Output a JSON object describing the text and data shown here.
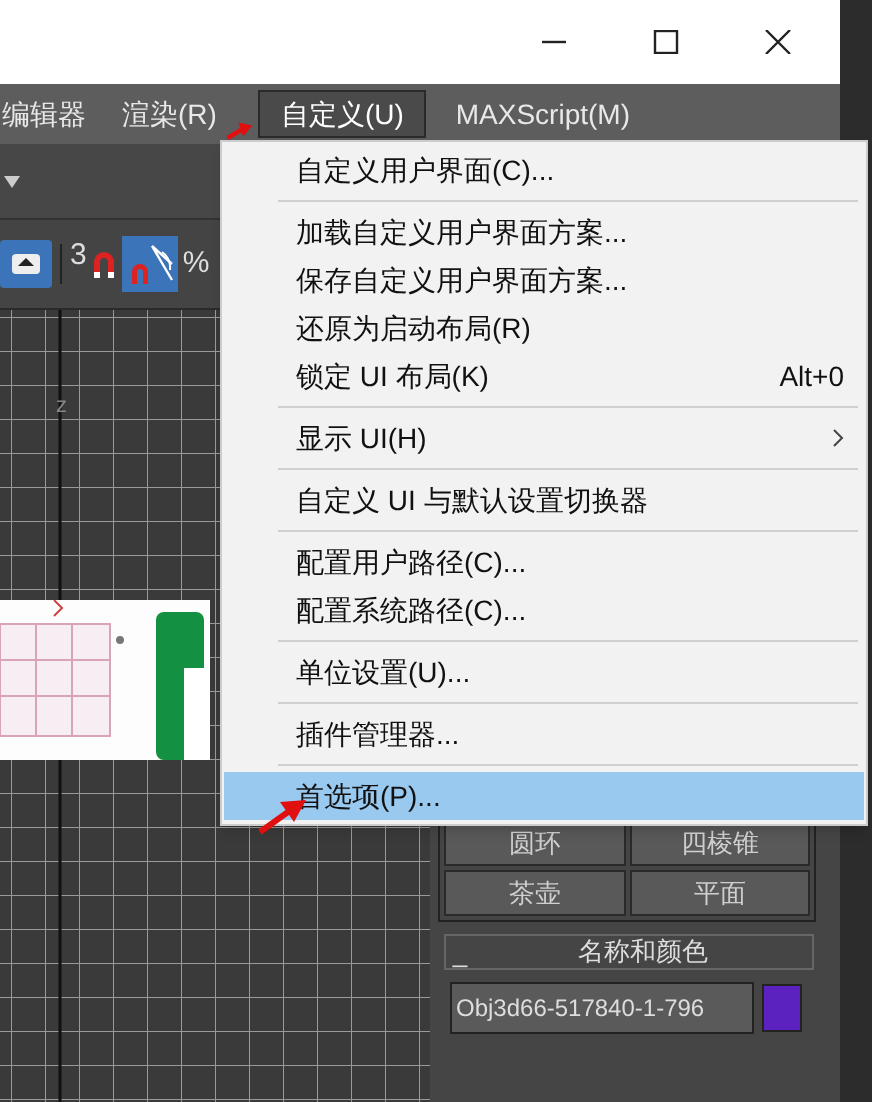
{
  "menubar": [
    {
      "label": "编辑器",
      "selected": false
    },
    {
      "label": "渲染(R)",
      "selected": false
    },
    {
      "label": "自定义(U)",
      "selected": true
    },
    {
      "label": "MAXScript(M)",
      "selected": false
    }
  ],
  "toolbar": {
    "snap_count": "3",
    "percent": "%"
  },
  "viewport": {
    "axis_label": "z"
  },
  "menu": {
    "groups": [
      [
        {
          "label": "自定义用户界面(C)...",
          "selected": false
        }
      ],
      [
        {
          "label": "加载自定义用户界面方案...",
          "selected": false
        },
        {
          "label": "保存自定义用户界面方案...",
          "selected": false
        },
        {
          "label": "还原为启动布局(R)",
          "selected": false
        },
        {
          "label": "锁定 UI 布局(K)",
          "shortcut": "Alt+0",
          "selected": false
        }
      ],
      [
        {
          "label": "显示 UI(H)",
          "submenu": true,
          "selected": false
        }
      ],
      [
        {
          "label": "自定义 UI 与默认设置切换器",
          "selected": false
        }
      ],
      [
        {
          "label": "配置用户路径(C)...",
          "selected": false
        },
        {
          "label": "配置系统路径(C)...",
          "selected": false
        }
      ],
      [
        {
          "label": "单位设置(U)...",
          "selected": false
        }
      ],
      [
        {
          "label": "插件管理器...",
          "selected": false
        }
      ],
      [
        {
          "label": "首选项(P)...",
          "selected": true
        }
      ]
    ]
  },
  "command_panel": {
    "object_buttons": [
      "圆环",
      "四棱锥",
      "茶壶",
      "平面"
    ],
    "rollout": {
      "title": "名称和颜色",
      "toggle": "_",
      "object_name": "Obj3d66-517840-1-796",
      "color": "#5b22c0"
    }
  }
}
